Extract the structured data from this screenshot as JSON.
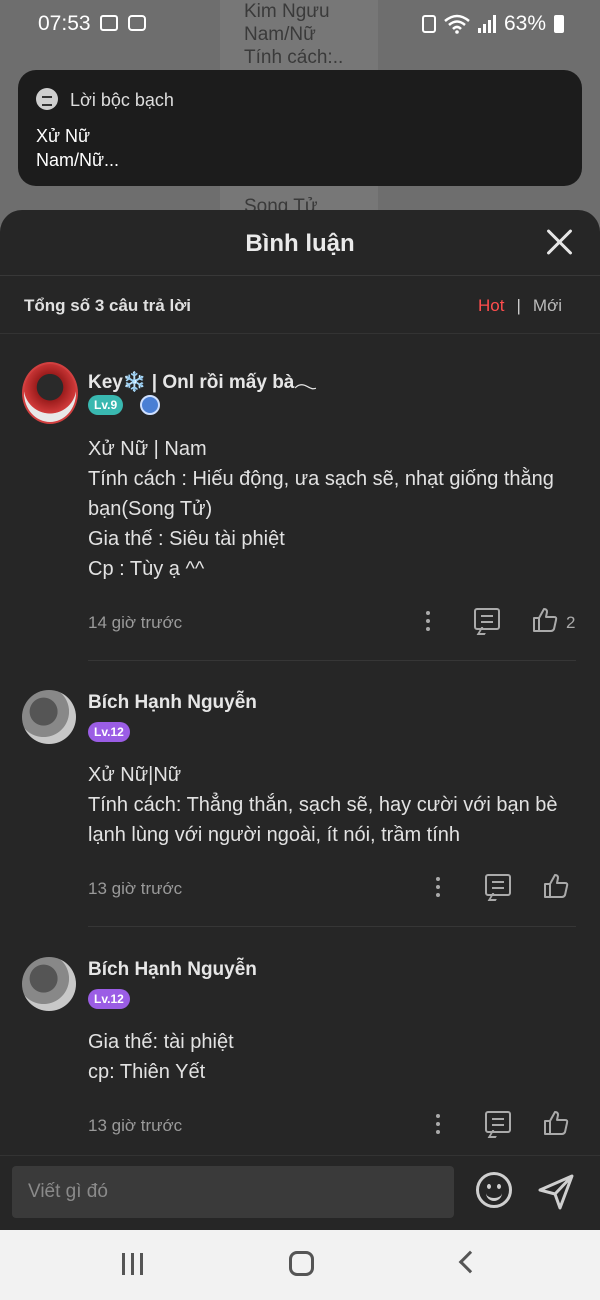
{
  "status_bar": {
    "time": "07:53",
    "battery": "63%"
  },
  "background": {
    "lines": [
      "Kim Ngưu",
      "Nam/Nữ",
      "Tính cách:.."
    ],
    "bottom_text": "Song Tử"
  },
  "notification": {
    "app_name": "Lời bộc bạch",
    "line1": "Xử Nữ",
    "line2": "Nam/Nữ..."
  },
  "sheet": {
    "title": "Bình luận",
    "total": "Tổng số 3 câu trả lời",
    "sort_hot": "Hot",
    "sort_sep": "|",
    "sort_new": "Mới"
  },
  "comments": [
    {
      "username": "Key❄️ | Onl rồi mấy bà𓂃",
      "level": "Lv.9",
      "lines": [
        "Xử Nữ | Nam",
        "Tính cách : Hiếu động, ưa sạch sẽ, nhạt giống thằng bạn(Song Tử)",
        "Gia thế : Siêu tài phiệt",
        "Cp : Tùy ạ ^^"
      ],
      "time": "14 giờ trước",
      "likes": "2"
    },
    {
      "username": "Bích Hạnh Nguyễn",
      "level": "Lv.12",
      "lines": [
        "Xử Nữ|Nữ",
        "Tính cách: Thẳng thắn, sạch sẽ, hay cười với bạn bè lạnh lùng với người ngoài, ít nói, trầm tính"
      ],
      "time": "13 giờ trước",
      "likes": ""
    },
    {
      "username": "Bích Hạnh Nguyễn",
      "level": "Lv.12",
      "lines": [
        "Gia thế: tài phiệt",
        "cp: Thiên Yết"
      ],
      "time": "13 giờ trước",
      "likes": ""
    }
  ],
  "input": {
    "placeholder": "Viết gì đó"
  },
  "colors": {
    "accent_hot": "#ff4d4d",
    "sheet_bg": "#262626",
    "level_teal": "#39b8b0",
    "level_purple": "#9b5de5"
  },
  "icons": [
    "gallery-icon",
    "screen-record-icon",
    "battery-saver-icon",
    "wifi-icon",
    "signal-icon",
    "close-icon",
    "more-icon",
    "reply-icon",
    "like-icon",
    "emoji-icon",
    "send-icon"
  ]
}
